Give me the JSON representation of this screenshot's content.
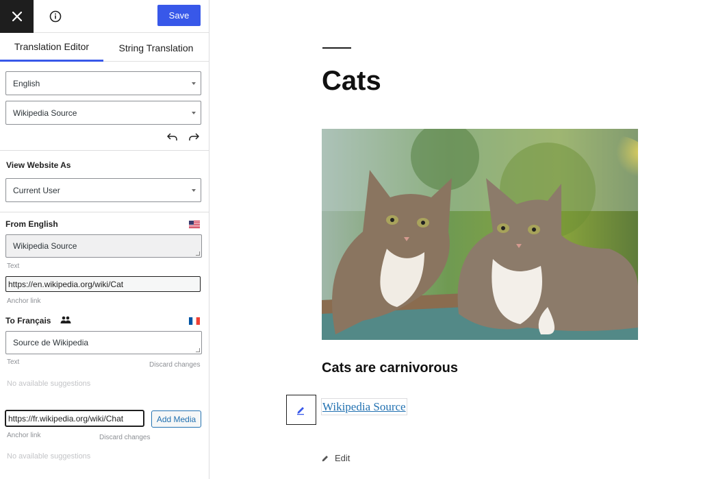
{
  "toolbar": {
    "save_label": "Save"
  },
  "tabs": [
    {
      "label": "Translation Editor"
    },
    {
      "label": "String Translation"
    }
  ],
  "selects": {
    "language": "English",
    "string": "Wikipedia Source"
  },
  "view_as": {
    "title": "View Website As",
    "value": "Current User"
  },
  "from": {
    "title": "From English",
    "text_value": "Wikipedia Source",
    "text_label": "Text",
    "anchor_value": "https://en.wikipedia.org/wiki/Cat",
    "anchor_label": "Anchor link"
  },
  "to": {
    "title": "To Français",
    "text_value": "Source de Wikipedia",
    "text_label": "Text",
    "discard_text": "Discard changes",
    "no_suggestions_1": "No available suggestions",
    "anchor_value": "https://fr.wikipedia.org/wiki/Chat",
    "add_media_label": "Add Media",
    "anchor_label": "Anchor link",
    "discard_anchor": "Discard changes",
    "no_suggestions_2": "No available suggestions"
  },
  "preview": {
    "title": "Cats",
    "subhead": "Cats are carnivorous",
    "link_text": "Wikipedia Source",
    "edit_label": "Edit"
  },
  "colors": {
    "accent": "#3858e9",
    "link": "#2271b1",
    "dark": "#1e1e1e"
  },
  "icons": [
    "close-icon",
    "info-icon",
    "undo-icon",
    "redo-icon",
    "us-flag-icon",
    "french-flag-icon",
    "people-icon",
    "pencil-icon"
  ]
}
